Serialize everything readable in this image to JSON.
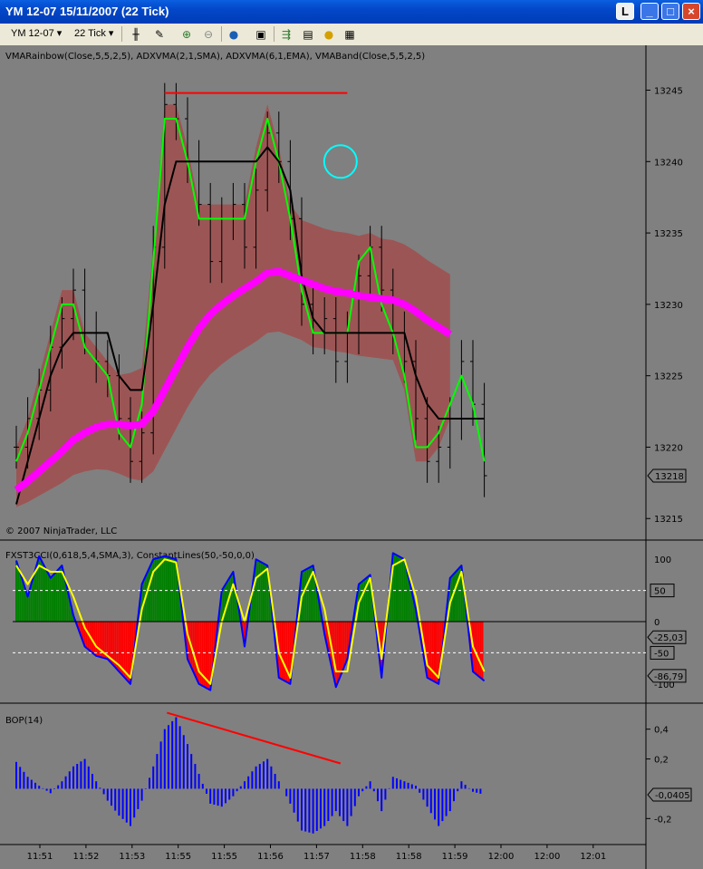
{
  "window": {
    "title": "YM 12-07  15/11/2007  (22 Tick)",
    "btn_l": "L",
    "btn_min": "_",
    "btn_max": "□",
    "btn_close": "×"
  },
  "toolbar": {
    "instrument": "YM 12-07",
    "interval": "22 Tick"
  },
  "copyright": "© 2007 NinjaTrader, LLC",
  "colors": {
    "background": "#808080",
    "price_bar": "#000000",
    "vma_rainbow": "#00ff00",
    "adxvma": "#000000",
    "vmaband": "#ff00ff",
    "band_fill": "#b23232",
    "cci_fast": "#0000ff",
    "cci_slow": "#ffff00",
    "hist_pos": "#008000",
    "hist_neg": "#ff0000",
    "bop": "#0000ff",
    "annotation": "#ff0000",
    "circle": "#00ffff"
  },
  "chart_data": [
    {
      "type": "line",
      "panel": "price",
      "title": "VMARainbow(Close,5,5,2,5), ADXVMA(2,1,SMA), ADXVMA(6,1,EMA), VMABand(Close,5,5,2,5)",
      "ylim": [
        13214,
        13247
      ],
      "yticks": [
        13215,
        13220,
        13225,
        13230,
        13235,
        13240,
        13245
      ],
      "ytick_labels": [
        "13215",
        "13220",
        "13225",
        "13230",
        "13235",
        "13240",
        "13245"
      ],
      "last_price_label": "13218",
      "x_minutes": [
        0,
        0.5,
        1,
        1.5,
        2,
        2.5,
        3,
        3.5,
        4,
        4.5,
        5,
        5.5,
        6,
        6.5,
        7,
        7.5,
        8,
        8.5,
        9,
        9.5,
        10,
        10.5,
        11,
        11.5,
        12,
        12.5,
        13,
        13.5,
        14,
        14.5,
        15,
        15.5,
        16,
        16.5,
        17,
        17.5,
        18,
        18.5,
        19,
        19.5,
        20,
        20.5
      ],
      "price": [
        13220,
        13222,
        13224,
        13227,
        13229,
        13231,
        13228,
        13226,
        13225,
        13222,
        13219,
        13221,
        13234,
        13244,
        13243,
        13240,
        13237,
        13233,
        13236,
        13237,
        13234,
        13238,
        13242,
        13240,
        13236,
        13230,
        13228,
        13229,
        13226,
        13228,
        13232,
        13234,
        13231,
        13228,
        13226,
        13222,
        13219,
        13220,
        13222,
        13226,
        13223,
        13218
      ],
      "series": [
        {
          "name": "VMARainbow",
          "values": [
            13219,
            13221,
            13224,
            13227,
            13230,
            13230,
            13227,
            13226,
            13225,
            13221,
            13220,
            13223,
            13233,
            13243,
            13243,
            13240,
            13236,
            13236,
            13236,
            13236,
            13236,
            13240,
            13243,
            13240,
            13236,
            13231,
            13228,
            13228,
            13228,
            13228,
            13233,
            13234,
            13230,
            13228,
            13225,
            13220,
            13220,
            13221,
            13223,
            13225,
            13223,
            13219
          ]
        },
        {
          "name": "ADXVMA",
          "values": [
            13216,
            13219,
            13222,
            13225,
            13227,
            13228,
            13228,
            13228,
            13228,
            13225,
            13224,
            13224,
            13230,
            13237,
            13240,
            13240,
            13240,
            13240,
            13240,
            13240,
            13240,
            13240,
            13241,
            13240,
            13238,
            13232,
            13229,
            13228,
            13228,
            13228,
            13228,
            13228,
            13228,
            13228,
            13228,
            13225,
            13223,
            13222,
            13222,
            13222,
            13222,
            13222
          ]
        },
        {
          "name": "VMABand",
          "values": [
            13217,
            13217.6,
            13218.3,
            13219,
            13219.7,
            13220.5,
            13221,
            13221.4,
            13221.6,
            13221.6,
            13221.5,
            13221.6,
            13222.5,
            13224,
            13225.5,
            13227,
            13228.3,
            13229.3,
            13230,
            13230.6,
            13231.1,
            13231.6,
            13232.2,
            13232.3,
            13232,
            13231.7,
            13231.4,
            13231.1,
            13230.9,
            13230.8,
            13230.6,
            13230.5,
            13230.4,
            13230.3,
            13230,
            13229.5,
            13228.9,
            13228.4,
            13227.9
          ]
        }
      ],
      "annotations": [
        {
          "type": "hline",
          "y": 13244.8,
          "x": [
            6.5,
            14.5
          ]
        },
        {
          "type": "circle",
          "x": 14.2,
          "y": 13240
        }
      ]
    },
    {
      "type": "bar",
      "panel": "cci",
      "title": "FXST3CCI(0,618,5,4,SMA,3), ConstantLines(50,-50,0,0)",
      "ylim": [
        -125,
        125
      ],
      "yticks": [
        100,
        0,
        -100
      ],
      "ytick_labels": [
        "100",
        "0",
        "-100"
      ],
      "constant_lines": [
        50,
        -50
      ],
      "constant_labels": [
        "50",
        "-50"
      ],
      "last_value_labels": [
        "-25,03",
        "-86,79"
      ],
      "x_minutes": [
        0,
        0.5,
        1,
        1.5,
        2,
        2.5,
        3,
        3.5,
        4,
        4.5,
        5,
        5.5,
        6,
        6.5,
        7,
        7.5,
        8,
        8.5,
        9,
        9.5,
        10,
        10.5,
        11,
        11.5,
        12,
        12.5,
        13,
        13.5,
        14,
        14.5,
        15,
        15.5,
        16,
        16.5,
        17,
        17.5,
        18,
        18.5,
        19,
        19.5,
        20,
        20.5
      ],
      "series": [
        {
          "name": "FXST3CCI",
          "values": [
            98,
            40,
            105,
            70,
            90,
            10,
            -40,
            -55,
            -60,
            -80,
            -100,
            60,
            100,
            105,
            100,
            -60,
            -100,
            -110,
            50,
            80,
            -40,
            100,
            90,
            -90,
            -100,
            80,
            90,
            -20,
            -105,
            -60,
            60,
            75,
            -90,
            110,
            100,
            20,
            -90,
            -100,
            70,
            90,
            -80,
            -95
          ]
        },
        {
          "name": "Signal",
          "values": [
            90,
            60,
            90,
            80,
            80,
            40,
            -10,
            -40,
            -55,
            -70,
            -90,
            20,
            80,
            100,
            95,
            -20,
            -80,
            -100,
            0,
            60,
            0,
            70,
            85,
            -50,
            -90,
            40,
            80,
            20,
            -80,
            -80,
            30,
            70,
            -60,
            90,
            100,
            40,
            -70,
            -90,
            30,
            80,
            -40,
            -80
          ]
        }
      ]
    },
    {
      "type": "bar",
      "panel": "bop",
      "title": "BOP(14)",
      "ylim": [
        -0.35,
        0.55
      ],
      "yticks": [
        0.4,
        0.2,
        -0.2
      ],
      "ytick_labels": [
        "0,4",
        "0,2",
        "-0,2"
      ],
      "last_value_label": "-0,0405",
      "x_minutes": [
        0,
        0.5,
        1,
        1.5,
        2,
        2.5,
        3,
        3.5,
        4,
        4.5,
        5,
        5.5,
        6,
        6.5,
        7,
        7.5,
        8,
        8.5,
        9,
        9.5,
        10,
        10.5,
        11,
        11.5,
        12,
        12.5,
        13,
        13.5,
        14,
        14.5,
        15,
        15.5,
        16,
        16.5,
        17,
        17.5,
        18,
        18.5,
        19,
        19.5,
        20,
        20.5
      ],
      "values": [
        0.18,
        0.08,
        0.02,
        -0.03,
        0.05,
        0.15,
        0.2,
        0.05,
        -0.08,
        -0.18,
        -0.25,
        -0.08,
        0.15,
        0.4,
        0.48,
        0.3,
        0.1,
        -0.1,
        -0.12,
        -0.05,
        0.05,
        0.15,
        0.2,
        0.05,
        -0.1,
        -0.28,
        -0.3,
        -0.25,
        -0.15,
        -0.25,
        -0.05,
        0.05,
        -0.15,
        0.08,
        0.05,
        0.02,
        -0.12,
        -0.25,
        -0.15,
        0.05,
        -0.02,
        -0.04
      ],
      "annotations": [
        {
          "type": "trendline",
          "from": [
            6.6,
            0.51
          ],
          "to": [
            14.2,
            0.17
          ]
        }
      ]
    }
  ],
  "time_axis": {
    "ticks": [
      0,
      2,
      4,
      6,
      8,
      10,
      12,
      14,
      16,
      18,
      20,
      22,
      24
    ],
    "labels": [
      "11:51",
      "11:52",
      "11:53",
      "11:55",
      "11:55",
      "11:56",
      "11:57",
      "11:58",
      "11:58",
      "11:59",
      "12:00",
      "12:00",
      "12:01"
    ]
  }
}
